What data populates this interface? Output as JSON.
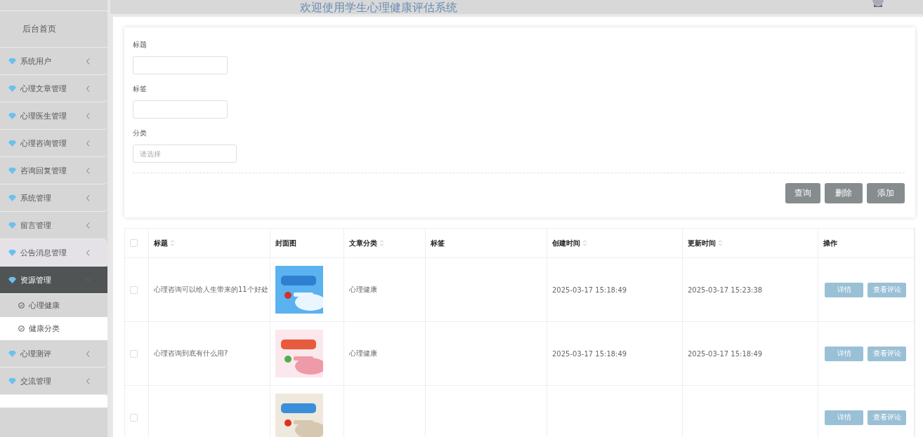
{
  "header": {
    "title": "欢迎使用学生心理健康评估系统"
  },
  "sidebar": {
    "home": "后台首页",
    "items": [
      {
        "label": "系统用户",
        "expanded": false,
        "hovered": false
      },
      {
        "label": "心理文章管理",
        "expanded": false,
        "hovered": false
      },
      {
        "label": "心理医生管理",
        "expanded": false,
        "hovered": false
      },
      {
        "label": "心理咨询管理",
        "expanded": false,
        "hovered": false
      },
      {
        "label": "咨询回复管理",
        "expanded": false,
        "hovered": false
      },
      {
        "label": "系统管理",
        "expanded": false,
        "hovered": false
      },
      {
        "label": "留言管理",
        "expanded": false,
        "hovered": false
      },
      {
        "label": "公告消息管理",
        "expanded": false,
        "hovered": true
      },
      {
        "label": "资源管理",
        "expanded": true,
        "hovered": false,
        "children": [
          {
            "label": "心理健康",
            "selected": false
          },
          {
            "label": "健康分类",
            "selected": true
          }
        ]
      },
      {
        "label": "心理测评",
        "expanded": false,
        "hovered": false
      },
      {
        "label": "交流管理",
        "expanded": false,
        "hovered": false
      }
    ]
  },
  "search_form": {
    "fields": [
      {
        "label": "标题",
        "kind": "text"
      },
      {
        "label": "标签",
        "kind": "text"
      },
      {
        "label": "分类",
        "kind": "select",
        "placeholder": "请选择"
      }
    ],
    "buttons": [
      "查询",
      "删除",
      "添加"
    ]
  },
  "table": {
    "all_checked": false,
    "columns": [
      {
        "label": "标题",
        "sortable": true
      },
      {
        "label": "封面图",
        "sortable": false
      },
      {
        "label": "文章分类",
        "sortable": true
      },
      {
        "label": "标签",
        "sortable": false
      },
      {
        "label": "创建时间",
        "sortable": true
      },
      {
        "label": "更新时间",
        "sortable": true
      },
      {
        "label": "操作",
        "sortable": false
      }
    ],
    "rows": [
      {
        "checked": false,
        "title": "心理咨询可以给人生带来的11个好处",
        "cover": {
          "kind": "picture"
        },
        "category": "心理健康",
        "created": "2025-03-17 15:18:49",
        "updated": "2025-03-17 15:23:38",
        "actions": [
          "详情",
          "查看评论"
        ]
      },
      {
        "checked": false,
        "title": "心理咨询到底有什么用?",
        "cover": {
          "kind": "picture"
        },
        "category": "心理健康",
        "created": "2025-03-17 15:18:49",
        "updated": "2025-03-17 15:18:49",
        "actions": [
          "详情",
          "查看评论"
        ]
      },
      {
        "checked": false,
        "cover": {
          "kind": "picture"
        },
        "actions": [
          "详情",
          "查看评论"
        ]
      }
    ]
  }
}
